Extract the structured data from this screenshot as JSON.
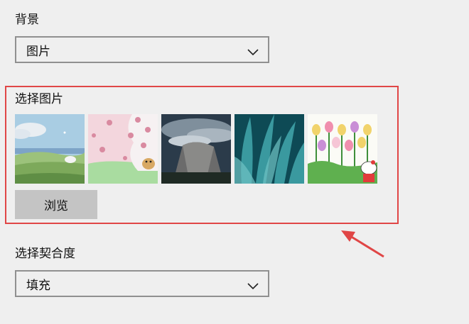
{
  "background": {
    "label": "背景",
    "selected": "图片"
  },
  "choose_picture": {
    "label": "选择图片",
    "thumbnails": [
      {
        "icon": "landscape-meadow-thumbnail"
      },
      {
        "icon": "pink-cherry-blossom-dog-thumbnail"
      },
      {
        "icon": "cloudy-mountain-cliff-thumbnail"
      },
      {
        "icon": "teal-succulent-leaves-thumbnail"
      },
      {
        "icon": "tulips-hello-kitty-thumbnail"
      }
    ],
    "browse_label": "浏览"
  },
  "fit": {
    "label": "选择契合度",
    "selected": "填充"
  },
  "colors": {
    "highlight": "#e04646",
    "button_bg": "#c4c4c4",
    "page_bg": "#efefef"
  }
}
